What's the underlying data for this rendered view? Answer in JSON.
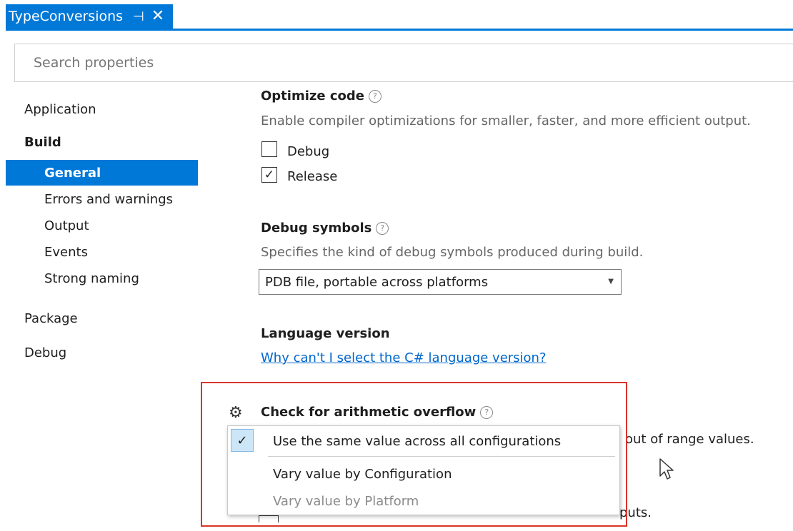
{
  "tab": {
    "title": "TypeConversions",
    "pin_icon": "⊣",
    "close_icon": "✕"
  },
  "search": {
    "placeholder": "Search properties"
  },
  "nav": {
    "application": "Application",
    "build": "Build",
    "general": "General",
    "errors": "Errors and warnings",
    "output": "Output",
    "events": "Events",
    "strong_naming": "Strong naming",
    "package": "Package",
    "debug": "Debug"
  },
  "optimize": {
    "title": "Optimize code",
    "desc": "Enable compiler optimizations for smaller, faster, and more efficient output.",
    "debug_label": "Debug",
    "debug_checked": false,
    "release_label": "Release",
    "release_checked": true
  },
  "symbols": {
    "title": "Debug symbols",
    "desc": "Specifies the kind of debug symbols produced during build.",
    "value": "PDB file, portable across platforms"
  },
  "language": {
    "title": "Language version",
    "link": "Why can't I select the C# language version?"
  },
  "overflow": {
    "title": "Check for arithmetic overflow",
    "desc_partial": "out of range values.",
    "next_partial": "puts."
  },
  "popup": {
    "item1": "Use the same value across all configurations",
    "item2": "Vary value by Configuration",
    "item3": "Vary value by Platform"
  },
  "glyphs": {
    "help": "?",
    "check": "✓",
    "gear": "⚙",
    "dropdown": "▼"
  },
  "colors": {
    "accent": "#0078d7",
    "highlight_border": "#d9342b",
    "link": "#0066cc"
  }
}
